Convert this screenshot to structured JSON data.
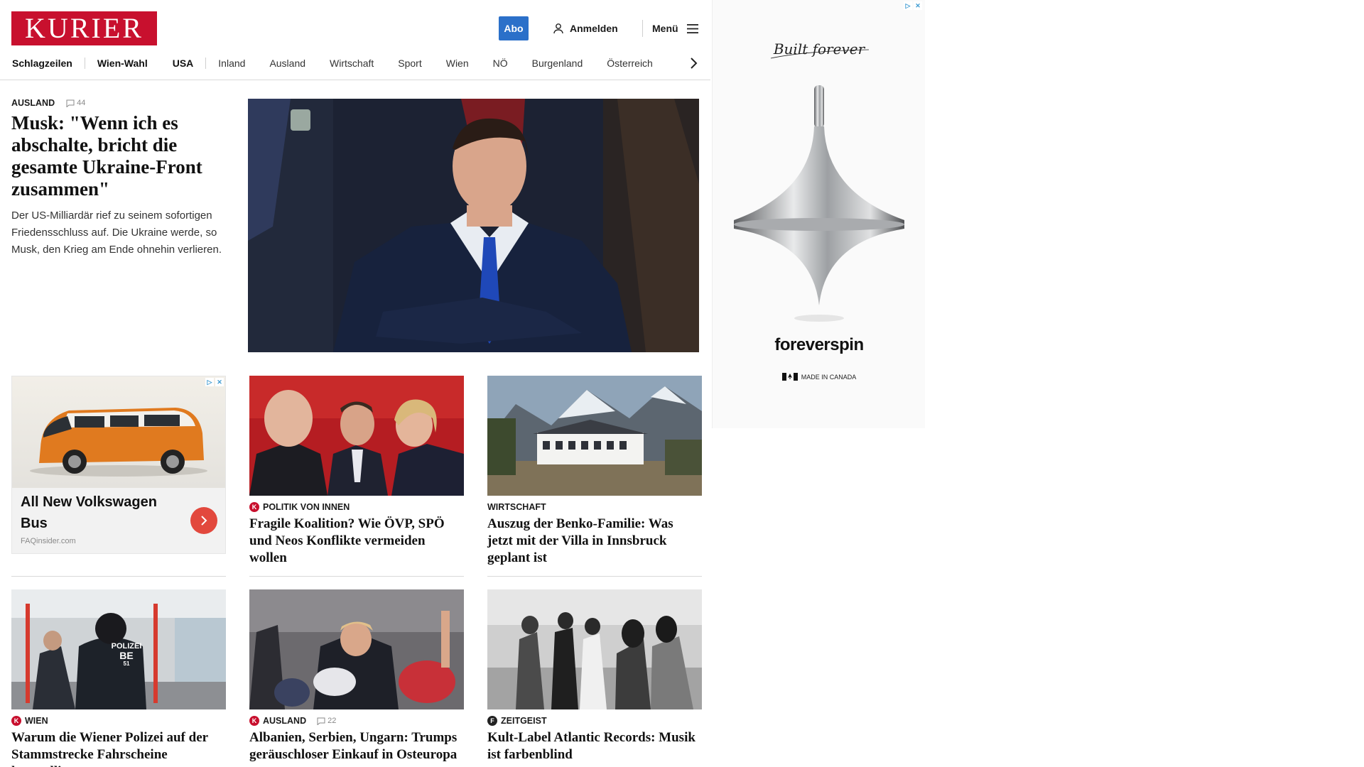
{
  "header": {
    "logo": "KURIER",
    "abo": "Abo",
    "login": "Anmelden",
    "menu": "Menü"
  },
  "nav": {
    "items": [
      "Schlagzeilen",
      "Wien-Wahl",
      "USA",
      "Inland",
      "Ausland",
      "Wirtschaft",
      "Sport",
      "Wien",
      "NÖ",
      "Burgenland",
      "Österreich"
    ]
  },
  "lead": {
    "kicker": "AUSLAND",
    "comments": "44",
    "headline": "Musk: \"Wenn ich es abschalte, bricht die gesamte Ukraine-Front zusammen\"",
    "teaser": "Der US-Milliardär rief zu seinem sofortigen Friedensschluss auf. Die Ukraine werde, so Musk, den Krieg am Ende ohnehin verlieren."
  },
  "ad_card": {
    "title": "All New Volkswagen Bus",
    "source": "FAQinsider.com"
  },
  "cards": [
    {
      "kicker": "POLITIK VON INNEN",
      "badge": "K",
      "headline": "Fragile Koalition? Wie ÖVP, SPÖ und Neos Konflikte vermeiden wollen"
    },
    {
      "kicker": "WIRTSCHAFT",
      "badge": "",
      "headline": "Auszug der Benko-Familie: Was jetzt mit der Villa in Innsbruck geplant ist"
    },
    {
      "kicker": "WIEN",
      "badge": "K",
      "headline": "Warum die Wiener Polizei auf der Stammstrecke Fahrscheine kontrolliert"
    },
    {
      "kicker": "AUSLAND",
      "badge": "K",
      "comments": "22",
      "headline": "Albanien, Serbien, Ungarn: Trumps geräuschloser Einkauf in Osteuropa"
    },
    {
      "kicker": "ZEITGEIST",
      "badge": "f",
      "headline": "Kult-Label Atlantic Records: Musik ist farbenblind"
    }
  ],
  "police_vest": {
    "line1": "POLIZEI",
    "line2": "BE",
    "line3": "51"
  },
  "side_ad": {
    "tagline": "Built forever",
    "brand": "foreverspin",
    "made": "MADE IN CANADA"
  },
  "colors": {
    "brand": "#c8102e",
    "abo": "#2b70c9",
    "ad_button": "#e2483d"
  }
}
